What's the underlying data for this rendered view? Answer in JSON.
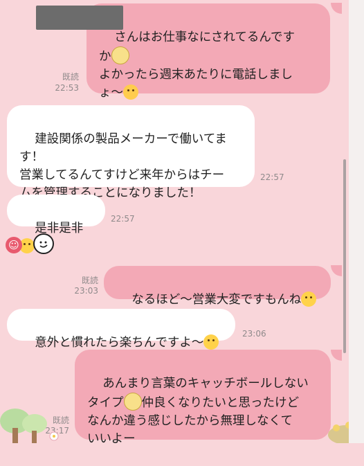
{
  "messages": [
    {
      "dir": "out",
      "text": "さんはお仕事なにされてるんです\nか",
      "text2": "\nよかったら週末あたりに電話しまし\nょ〜",
      "read": "既読",
      "time": "22:53"
    },
    {
      "dir": "in",
      "text": "建設関係の製品メーカーで働いてま\nす！\n営業してるんてすけど来年からはチー\nムを管理することになりました！",
      "time": "22:57"
    },
    {
      "dir": "in",
      "text": "是非是非",
      "time": "22:57"
    },
    {
      "dir": "out",
      "text": "なるほど〜営業大変ですもんね",
      "read": "既読",
      "time": "23:03"
    },
    {
      "dir": "in",
      "text": "意外と慣れたら楽ちんですよ〜",
      "time": "23:06"
    },
    {
      "dir": "out",
      "text": "あんまり言葉のキャッチボールしない\nタイプ",
      "text2": "仲良くなりたいと思ったけど\nなんか違う感じしたから無理しなくて\nいいよー",
      "read": "既読",
      "time": "23:17"
    }
  ],
  "icons": {
    "reaction": "smile-reaction-icon",
    "sticker": "smiley-sticker-icon"
  },
  "colors": {
    "background": "#f9d6da",
    "incoming_bubble": "#ffffff",
    "outgoing_bubble": "#f3a9b6"
  }
}
